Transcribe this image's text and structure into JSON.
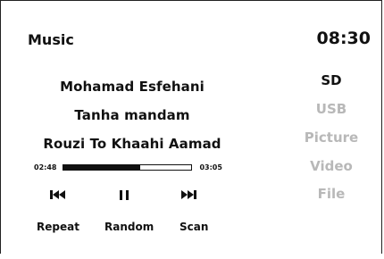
{
  "header": {
    "title": "Music",
    "time": "08:30"
  },
  "now_playing": {
    "artist": "Mohamad Esfehani",
    "album": "Tanha mandam",
    "song": "Rouzi To Khaahi Aamad",
    "elapsed": "02:48",
    "duration": "03:05",
    "progress": 0.6
  },
  "controls": {
    "prev_icon": "skip-previous-icon",
    "pause_icon": "pause-icon",
    "next_icon": "skip-next-icon"
  },
  "modes": {
    "repeat_label": "Repeat",
    "random_label": "Random",
    "scan_label": "Scan"
  },
  "sources": [
    {
      "label": "SD",
      "active": true
    },
    {
      "label": "USB",
      "active": false
    },
    {
      "label": "Picture",
      "active": false
    },
    {
      "label": "Video",
      "active": false
    },
    {
      "label": "File",
      "active": false
    }
  ],
  "colors": {
    "text": "#111111",
    "inactive": "#b8b8b8",
    "background": "#ffffff"
  }
}
